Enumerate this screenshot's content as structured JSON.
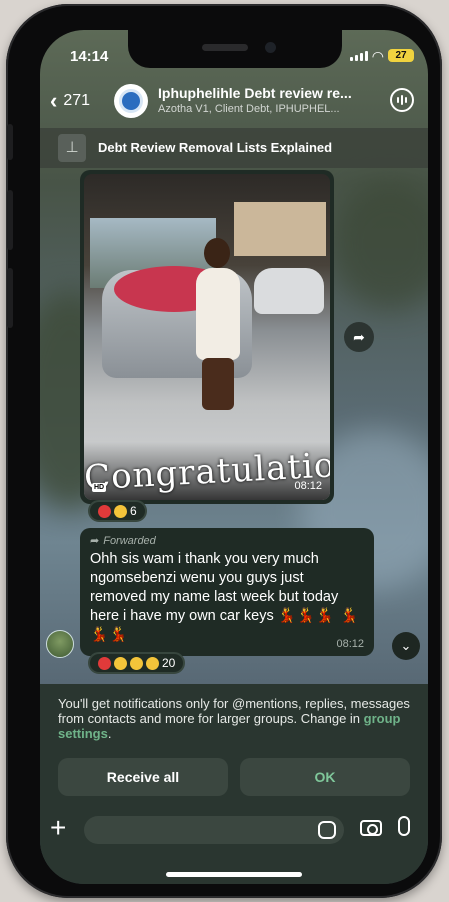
{
  "status": {
    "time": "14:14",
    "battery": "27"
  },
  "header": {
    "back_count": "271",
    "title": "Iphuphelihle Debt review re...",
    "subtitle": "Azotha V1, Client Debt, IPHUPHEL..."
  },
  "pinned": {
    "text": "Debt Review Removal Lists Explained"
  },
  "image_message": {
    "caption_overlay": "Congratulations",
    "time": "08:12",
    "reactions_count": "6"
  },
  "text_message": {
    "forwarded_label": "Forwarded",
    "body": "Ohh sis wam i thank you very much ngomsebenzi wenu you guys just removed my name last week but today here i have my own car keys",
    "time": "08:12",
    "reactions_count": "20"
  },
  "notification": {
    "text": "You'll get notifications only for @mentions, replies, messages from contacts and more for larger groups. Change in",
    "link": "group settings",
    "suffix": ".",
    "receive_all_label": "Receive all",
    "ok_label": "OK"
  },
  "colors": {
    "accent_green": "#7fc79a",
    "bubble": "#1f2b25",
    "panel": "#2a3630"
  }
}
